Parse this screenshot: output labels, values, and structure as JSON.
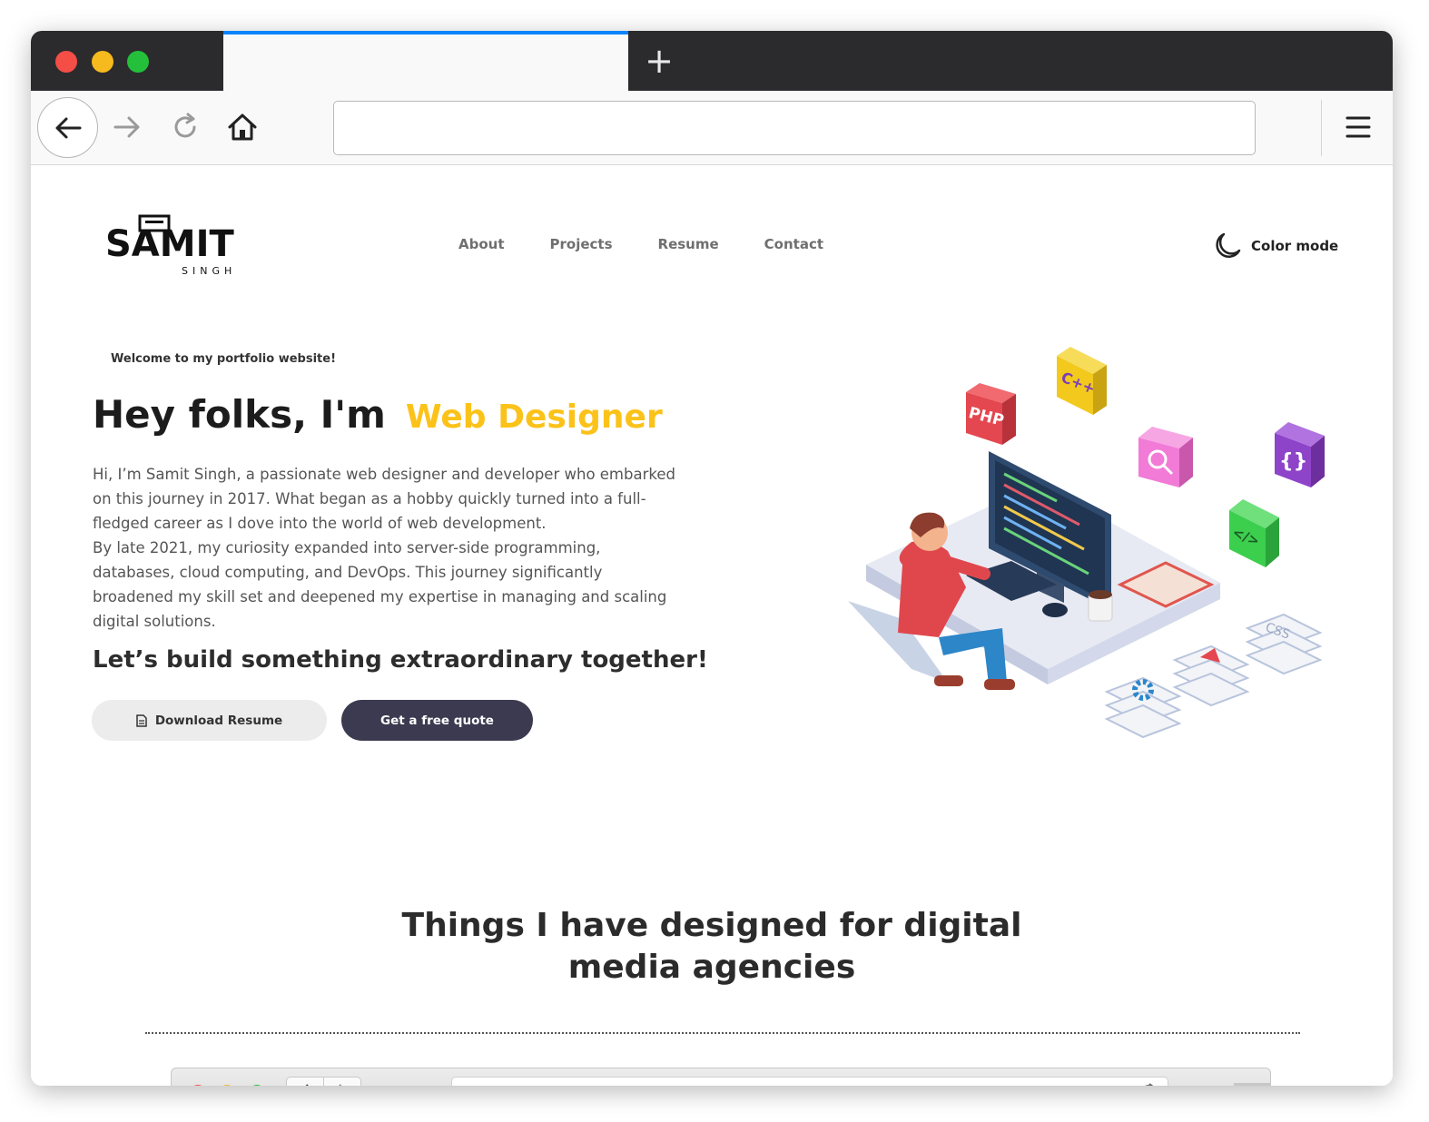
{
  "browser": {
    "new_tab_symbol": "+",
    "url_value": ""
  },
  "site": {
    "logo": {
      "main": "SAMIT",
      "sub": "SINGH"
    },
    "nav": [
      {
        "label": "About"
      },
      {
        "label": "Projects"
      },
      {
        "label": "Resume"
      },
      {
        "label": "Contact"
      }
    ],
    "color_mode_label": "Color mode"
  },
  "hero": {
    "welcome": "Welcome to my portfolio website!",
    "title_prefix": "Hey folks, I'm",
    "title_role": "Web Designer",
    "paragraph_lines": [
      "Hi, I’m Samit Singh, a passionate web designer and developer who embarked",
      "on this journey in 2017. What began as a hobby quickly turned into a full-",
      "fledged career as I dove into the world of web development.",
      "By late 2021, my curiosity expanded into server-side programming,",
      "databases, cloud computing, and DevOps. This journey significantly",
      "broadened my skill set and deepened my expertise in managing and scaling",
      "digital solutions."
    ],
    "cta_heading": "Let’s build something extraordinary together!",
    "download_button": "Download Resume",
    "quote_button": "Get a free quote",
    "illustration_labels": {
      "php": "PHP",
      "cpp": "C++",
      "braces": "{}",
      "code": "</>",
      "css": "CSS"
    }
  },
  "section": {
    "title_line1": "Things I have designed for digital",
    "title_line2": "media agencies"
  },
  "colors": {
    "accent_yellow": "#fbc219",
    "button_dark": "#3b3a50",
    "tab_highlight": "#0a84ff",
    "titlebar": "#2b2b2d"
  },
  "icons": {
    "back": "back-arrow-icon",
    "forward": "forward-arrow-icon",
    "reload": "reload-icon",
    "home": "home-icon",
    "menu": "hamburger-menu-icon",
    "color_mode": "moon-icon",
    "download": "document-icon"
  }
}
